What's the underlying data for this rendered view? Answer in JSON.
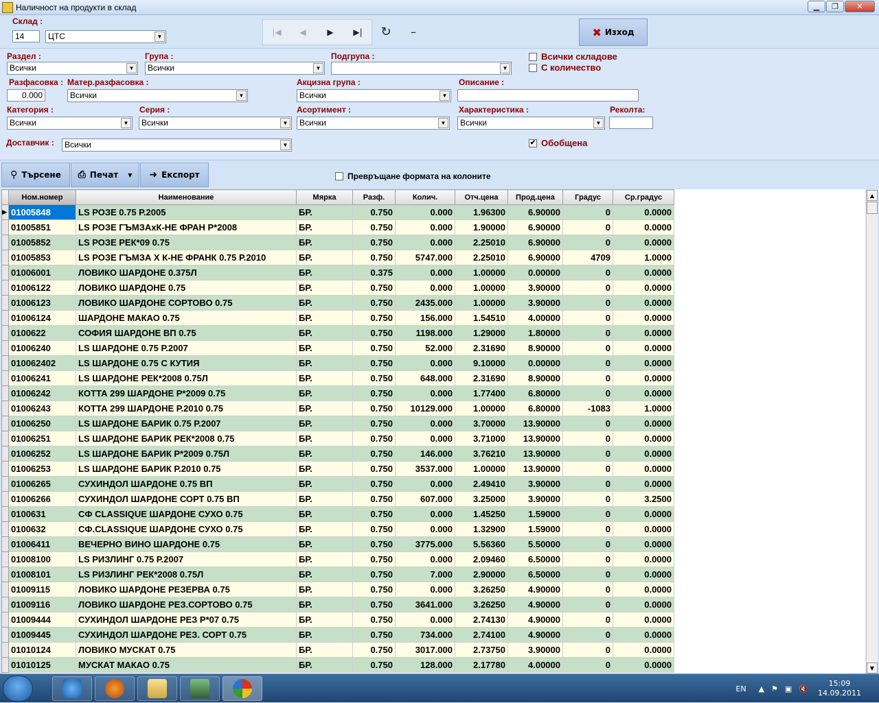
{
  "window": {
    "title": "Наличност на продукти в склад"
  },
  "warehouse": {
    "label": "Склад :",
    "code": "14",
    "name": "ЦТС"
  },
  "exit_label": "Изход",
  "filters": {
    "section_label": "Раздел :",
    "section_value": "Всички",
    "group_label": "Група :",
    "group_value": "Всички",
    "subgroup_label": "Подгрупа :",
    "subgroup_value": "",
    "all_warehouses_label": "Всички складове",
    "with_quantity_label": "С количество",
    "packaging_label": "Разфасовка :",
    "packaging_value": "0.000",
    "mat_packaging_label": "Матер.разфасовка :",
    "mat_packaging_value": "Всички",
    "excise_label": "Акцизна група :",
    "excise_value": "Всички",
    "description_label": "Описание :",
    "description_value": "",
    "category_label": "Категория :",
    "category_value": "Всички",
    "series_label": "Серия :",
    "series_value": "Всички",
    "assortment_label": "Асортимент :",
    "assortment_value": "Всички",
    "characteristic_label": "Характеристика :",
    "characteristic_value": "Всички",
    "harvest_label": "Реколта:",
    "harvest_value": "",
    "supplier_label": "Доставчик :",
    "supplier_value": "Всички",
    "summarized_label": "Обобщена",
    "summarized_checked": "✔"
  },
  "actions": {
    "search": "Търсене",
    "print": "Печат",
    "export": "Експорт",
    "convert_label": "Превръщане формата на колоните"
  },
  "table": {
    "headers": [
      "Ном.номер",
      "Наименование",
      "Мярка",
      "Разф.",
      "Колич.",
      "Отч.цена",
      "Прод.цена",
      "Градус",
      "Ср.градус"
    ],
    "rows": [
      [
        "01005848",
        "LS РОЗЕ 0.75 Р.2005",
        "БР.",
        "0.750",
        "0.000",
        "1.96300",
        "6.90000",
        "0",
        "0.0000"
      ],
      [
        "01005851",
        "LS РОЗЕ ГЪМЗАхК-НЕ ФРАН Р*2008",
        "БР.",
        "0.750",
        "0.000",
        "1.90000",
        "6.90000",
        "0",
        "0.0000"
      ],
      [
        "01005852",
        "LS РОЗЕ РЕК*09  0.75",
        "БР.",
        "0.750",
        "0.000",
        "2.25010",
        "6.90000",
        "0",
        "0.0000"
      ],
      [
        "01005853",
        "LS РОЗЕ ГЪМЗА Х К-НЕ ФРАНК 0.75 Р.2010",
        "БР.",
        "0.750",
        "5747.000",
        "2.25010",
        "6.90000",
        "4709",
        "1.0000"
      ],
      [
        "01006001",
        "ЛОВИКО ШАРДОНЕ 0.375Л",
        "БР.",
        "0.375",
        "0.000",
        "1.00000",
        "0.00000",
        "0",
        "0.0000"
      ],
      [
        "01006122",
        "ЛОВИКО ШАРДОНЕ 0.75",
        "БР.",
        "0.750",
        "0.000",
        "1.00000",
        "3.90000",
        "0",
        "0.0000"
      ],
      [
        "01006123",
        "ЛОВИКО ШАРДОНЕ СОРТОВО 0.75",
        "БР.",
        "0.750",
        "2435.000",
        "1.00000",
        "3.90000",
        "0",
        "0.0000"
      ],
      [
        "01006124",
        "ШАРДОНЕ МАКАО 0.75",
        "БР.",
        "0.750",
        "156.000",
        "1.54510",
        "4.00000",
        "0",
        "0.0000"
      ],
      [
        "0100622",
        "СОФИЯ ШАРДОНЕ ВП 0.75",
        "БР.",
        "0.750",
        "1198.000",
        "1.29000",
        "1.80000",
        "0",
        "0.0000"
      ],
      [
        "01006240",
        "LS ШАРДОНЕ 0.75 Р.2007",
        "БР.",
        "0.750",
        "52.000",
        "2.31690",
        "8.90000",
        "0",
        "0.0000"
      ],
      [
        "010062402",
        "LS ШАРДОНЕ 0.75 С КУТИЯ",
        "БР.",
        "0.750",
        "0.000",
        "9.10000",
        "0.00000",
        "0",
        "0.0000"
      ],
      [
        "01006241",
        "LS ШАРДОНЕ РЕК*2008  0.75Л",
        "БР.",
        "0.750",
        "648.000",
        "2.31690",
        "8.90000",
        "0",
        "0.0000"
      ],
      [
        "01006242",
        "КОТТА 299 ШАРДОНЕ Р*2009  0.75",
        "БР.",
        "0.750",
        "0.000",
        "1.77400",
        "6.80000",
        "0",
        "0.0000"
      ],
      [
        "01006243",
        "КОТТА 299 ШАРДОНЕ Р.2010 0.75",
        "БР.",
        "0.750",
        "10129.000",
        "1.00000",
        "6.80000",
        "-1083",
        "1.0000"
      ],
      [
        "01006250",
        "LS ШАРДОНЕ БАРИК 0.75 Р.2007",
        "БР.",
        "0.750",
        "0.000",
        "3.70000",
        "13.90000",
        "0",
        "0.0000"
      ],
      [
        "01006251",
        "LS ШАРДОНЕ БАРИК РЕК*2008 0.75",
        "БР.",
        "0.750",
        "0.000",
        "3.71000",
        "13.90000",
        "0",
        "0.0000"
      ],
      [
        "01006252",
        "LS ШАРДОНЕ БАРИК Р*2009  0.75Л",
        "БР.",
        "0.750",
        "146.000",
        "3.76210",
        "13.90000",
        "0",
        "0.0000"
      ],
      [
        "01006253",
        "LS ШАРДОНЕ БАРИК Р.2010 0.75",
        "БР.",
        "0.750",
        "3537.000",
        "1.00000",
        "13.90000",
        "0",
        "0.0000"
      ],
      [
        "01006265",
        "СУХИНДОЛ ШАРДОНЕ 0.75 ВП",
        "БР.",
        "0.750",
        "0.000",
        "2.49410",
        "3.90000",
        "0",
        "0.0000"
      ],
      [
        "01006266",
        "СУХИНДОЛ ШАРДОНЕ СОРТ 0.75  ВП",
        "БР.",
        "0.750",
        "607.000",
        "3.25000",
        "3.90000",
        "0",
        "3.2500"
      ],
      [
        "0100631",
        "СФ CLASSIQUE ШАРДОНЕ СУХО 0.75",
        "БР.",
        "0.750",
        "0.000",
        "1.45250",
        "1.59000",
        "0",
        "0.0000"
      ],
      [
        "0100632",
        "СФ.CLASSIQUE ШАРДОНЕ СУХО 0.75",
        "БР.",
        "0.750",
        "0.000",
        "1.32900",
        "1.59000",
        "0",
        "0.0000"
      ],
      [
        "01006411",
        "ВЕЧЕРНО ВИНО ШАРДОНЕ 0.75",
        "БР.",
        "0.750",
        "3775.000",
        "5.56360",
        "5.50000",
        "0",
        "0.0000"
      ],
      [
        "01008100",
        "LS РИЗЛИНГ 0.75 Р.2007",
        "БР.",
        "0.750",
        "0.000",
        "2.09460",
        "6.50000",
        "0",
        "0.0000"
      ],
      [
        "01008101",
        "LS РИЗЛИНГ РЕК*2008  0.75Л",
        "БР.",
        "0.750",
        "7.000",
        "2.90000",
        "6.50000",
        "0",
        "0.0000"
      ],
      [
        "01009115",
        "ЛОВИКО ШАРДОНЕ РЕЗЕРВА 0.75",
        "БР.",
        "0.750",
        "0.000",
        "3.26250",
        "4.90000",
        "0",
        "0.0000"
      ],
      [
        "01009116",
        "ЛОВИКО ШАРДОНЕ РЕЗ.СОРТОВО 0.75",
        "БР.",
        "0.750",
        "3641.000",
        "3.26250",
        "4.90000",
        "0",
        "0.0000"
      ],
      [
        "01009444",
        "СУХИНДОЛ ШАРДОНЕ РЕЗ Р*07 0.75",
        "БР.",
        "0.750",
        "0.000",
        "2.74130",
        "4.90000",
        "0",
        "0.0000"
      ],
      [
        "01009445",
        "СУХИНДОЛ ШАРДОНЕ РЕЗ. СОРТ 0.75",
        "БР.",
        "0.750",
        "734.000",
        "2.74100",
        "4.90000",
        "0",
        "0.0000"
      ],
      [
        "01010124",
        "ЛОВИКО МУСКАТ 0.75",
        "БР.",
        "0.750",
        "3017.000",
        "2.73750",
        "3.90000",
        "0",
        "0.0000"
      ],
      [
        "01010125",
        "МУСКАТ МАКАО 0.75",
        "БР.",
        "0.750",
        "128.000",
        "2.17780",
        "4.00000",
        "0",
        "0.0000"
      ]
    ]
  },
  "taskbar": {
    "lang": "EN",
    "time": "15:09",
    "date": "14.09.2011"
  }
}
